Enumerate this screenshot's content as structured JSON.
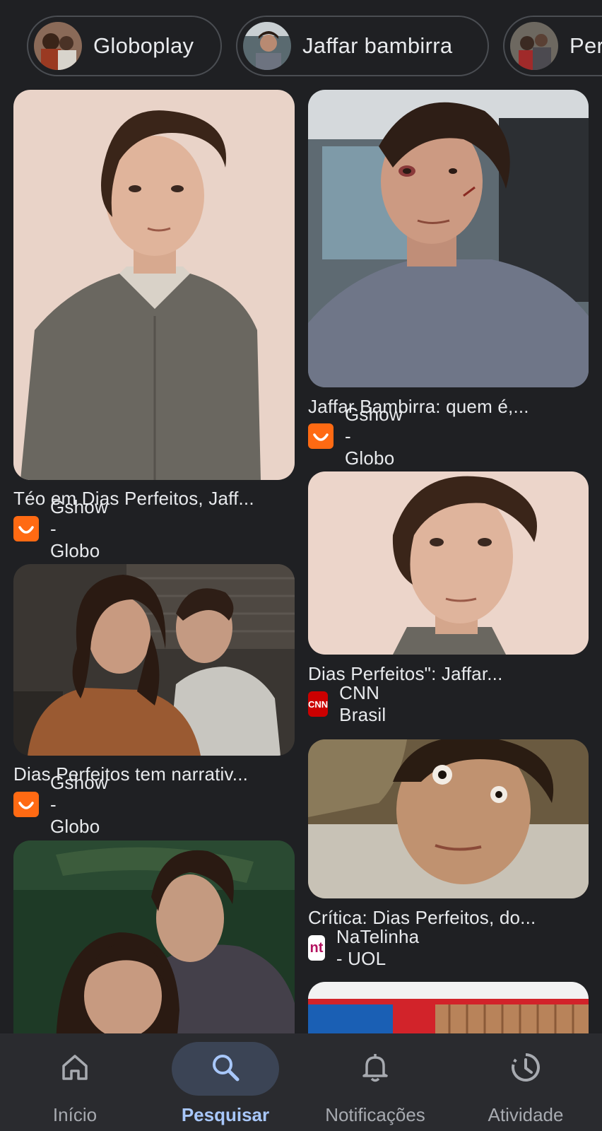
{
  "chips": [
    {
      "label": "Globoplay",
      "avatar": "people-photo"
    },
    {
      "label": "Jaffar bambirra",
      "avatar": "person-photo"
    },
    {
      "label": "Perf",
      "avatar": "people-photo"
    }
  ],
  "results": [
    {
      "title": "Téo em Dias Perfeitos, Jaff...",
      "source": "Gshow - Globo",
      "favicon": "gshow-icon"
    },
    {
      "title": "Jaffar Bambirra: quem é,...",
      "source": "Gshow - Globo",
      "favicon": "gshow-icon"
    },
    {
      "title": "Dias Perfeitos tem narrativ...",
      "source": "Gshow - Globo",
      "favicon": "gshow-icon"
    },
    {
      "title": "Dias Perfeitos\": Jaffar...",
      "source": "CNN Brasil",
      "favicon": "cnn-icon",
      "favicon_text": "CNN"
    },
    {
      "title": "Crítica: Dias Perfeitos, do...",
      "source": "NaTelinha - UOL",
      "favicon": "natelinha-icon",
      "favicon_text": "nt"
    }
  ],
  "bottom_nav": [
    {
      "label": "Início",
      "icon": "home-icon",
      "active": false
    },
    {
      "label": "Pesquisar",
      "icon": "search-icon",
      "active": true
    },
    {
      "label": "Notificações",
      "icon": "bell-icon",
      "active": false
    },
    {
      "label": "Atividade",
      "icon": "activity-icon",
      "active": false
    }
  ],
  "colors": {
    "background": "#1f2023",
    "nav_background": "#2a2b2f",
    "active_accent": "#a8c7fa",
    "gshow": "#ff6a13",
    "cnn": "#cc0000"
  }
}
